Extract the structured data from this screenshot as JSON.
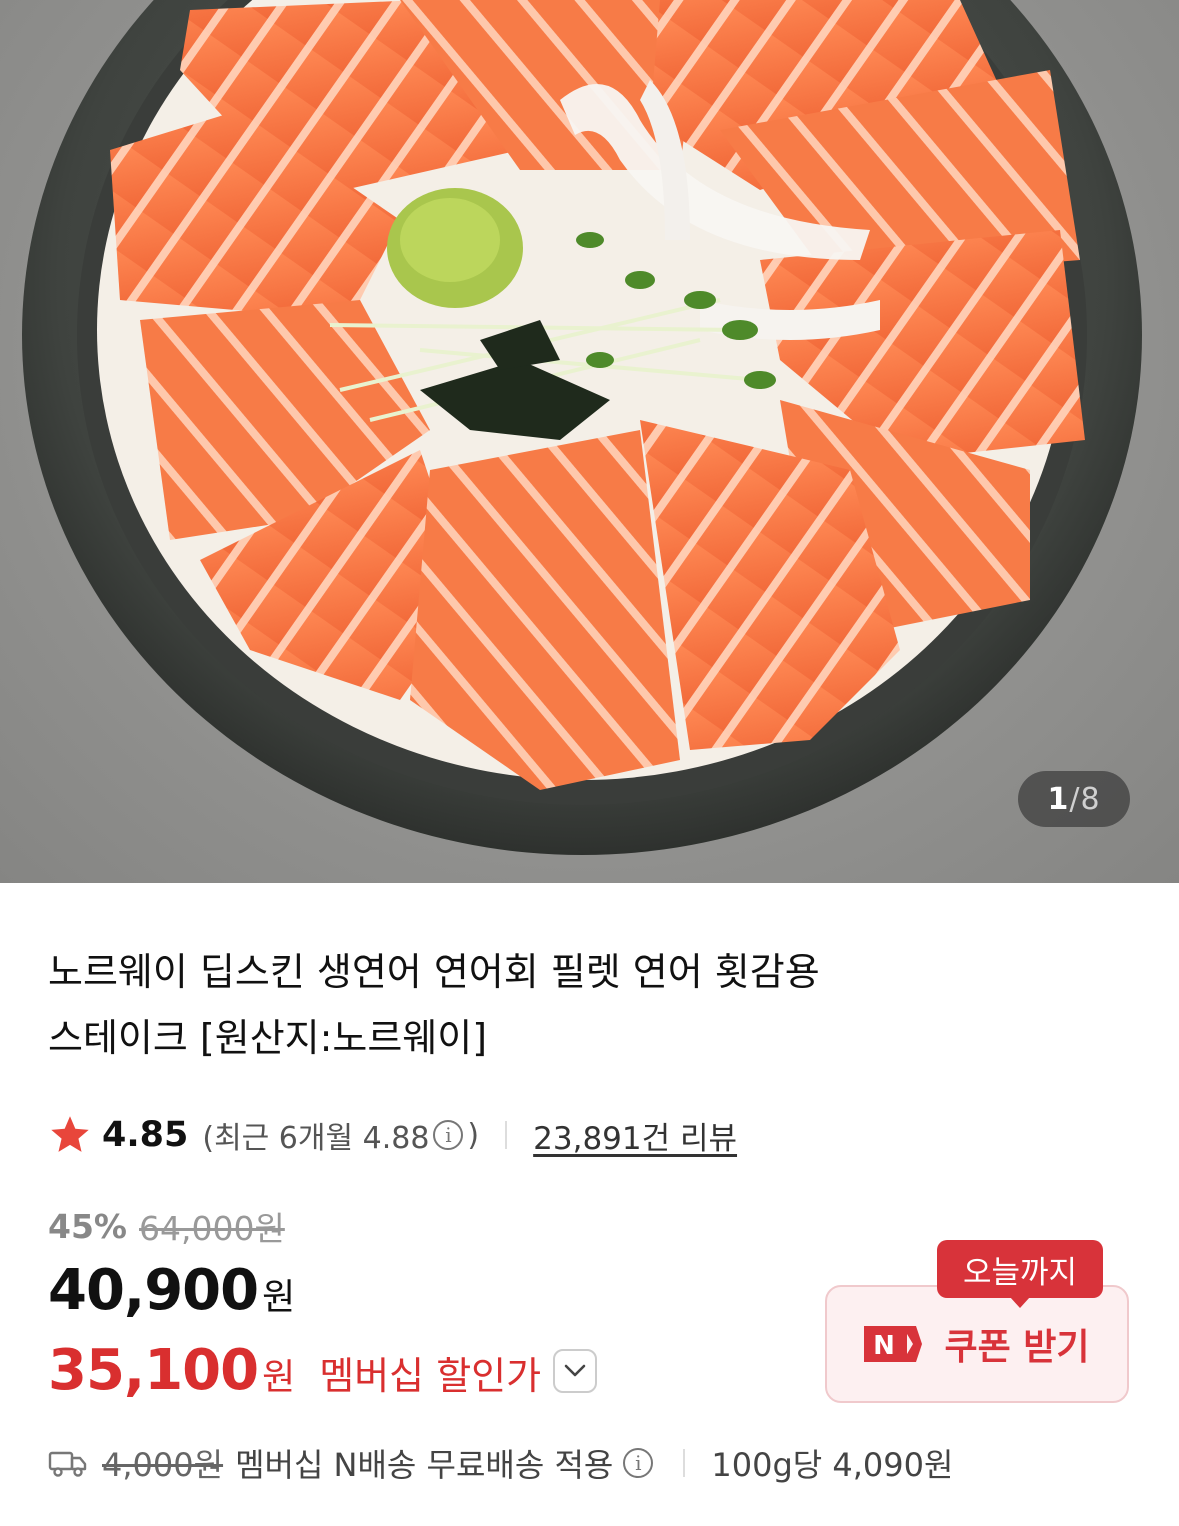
{
  "gallery": {
    "image_alt": "salmon-rice-bowl-photo",
    "current": "1",
    "separator": "/",
    "total": "8"
  },
  "product": {
    "title_line1": "노르웨이 딥스킨 생연어 연어회 필렛 연어 횟감용",
    "title_line2": "스테이크 [원산지:노르웨이]"
  },
  "rating": {
    "score": "4.85",
    "recent_prefix": "(최근 6개월 4.88",
    "recent_suffix": ")",
    "info_icon": "info-icon",
    "review_count": "23,891건 리뷰"
  },
  "price": {
    "discount_pct": "45%",
    "original": "64,000원",
    "sale_number": "40,900",
    "sale_unit": "원",
    "member_number": "35,100",
    "member_unit": "원",
    "member_label": "멤버십 할인가"
  },
  "coupon": {
    "badge": "오늘까지",
    "label": "쿠폰 받기",
    "logo_letter": "N"
  },
  "delivery": {
    "shipping_original": "4,000원",
    "shipping_text": "멤버십 N배송 무료배송 적용",
    "unit_price": "100g당 4,090원"
  },
  "colors": {
    "accent_red": "#d92f2f",
    "badge_red": "#d8333a",
    "star": "#e8463b"
  }
}
